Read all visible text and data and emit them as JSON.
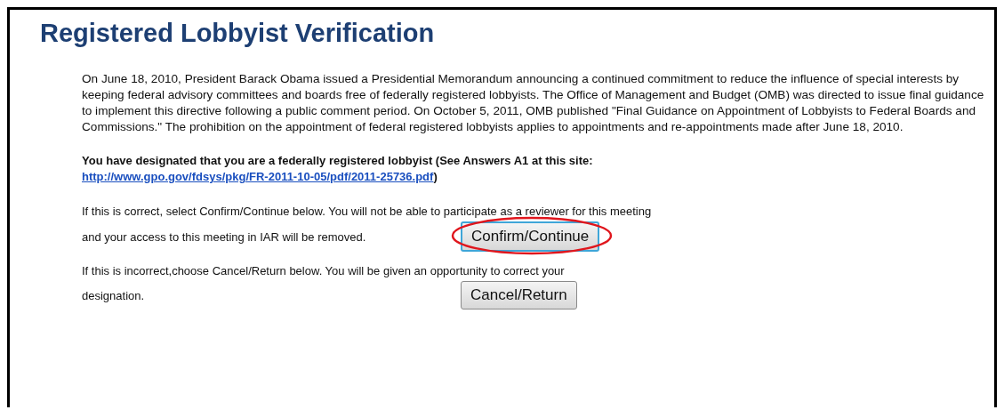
{
  "title": "Registered Lobbyist Verification",
  "intro": "On June 18, 2010, President Barack Obama issued a Presidential Memorandum announcing a continued commitment to reduce the influence of special interests by keeping federal advisory committees and boards free of federally registered lobbyists. The Office of Management and Budget (OMB) was directed to issue final guidance to implement this directive following a public comment period. On October 5, 2011, OMB published \"Final Guidance on Appointment of Lobbyists to Federal Boards and Commissions.\" The prohibition on the appointment of federal registered lobbyists applies to appointments and re-appointments made after June 18, 2010.",
  "designation": {
    "text": "You have designated that you are a federally registered lobbyist (See Answers A1 at this site:",
    "link": "http://www.gpo.gov/fdsys/pkg/FR-2011-10-05/pdf/2011-25736.pdf",
    "closing": ")"
  },
  "choices": [
    {
      "line1": "If this is correct, select Confirm/Continue below. You will not be able to participate as a reviewer for this meeting",
      "line2": "and your access to this meeting in IAR will be removed.",
      "button": "Confirm/Continue",
      "focused": true,
      "highlighted": true
    },
    {
      "line1": "If this is incorrect,choose Cancel/Return below. You will be given an opportunity to correct your",
      "line2": "designation.",
      "button": "Cancel/Return",
      "focused": false,
      "highlighted": false
    }
  ]
}
